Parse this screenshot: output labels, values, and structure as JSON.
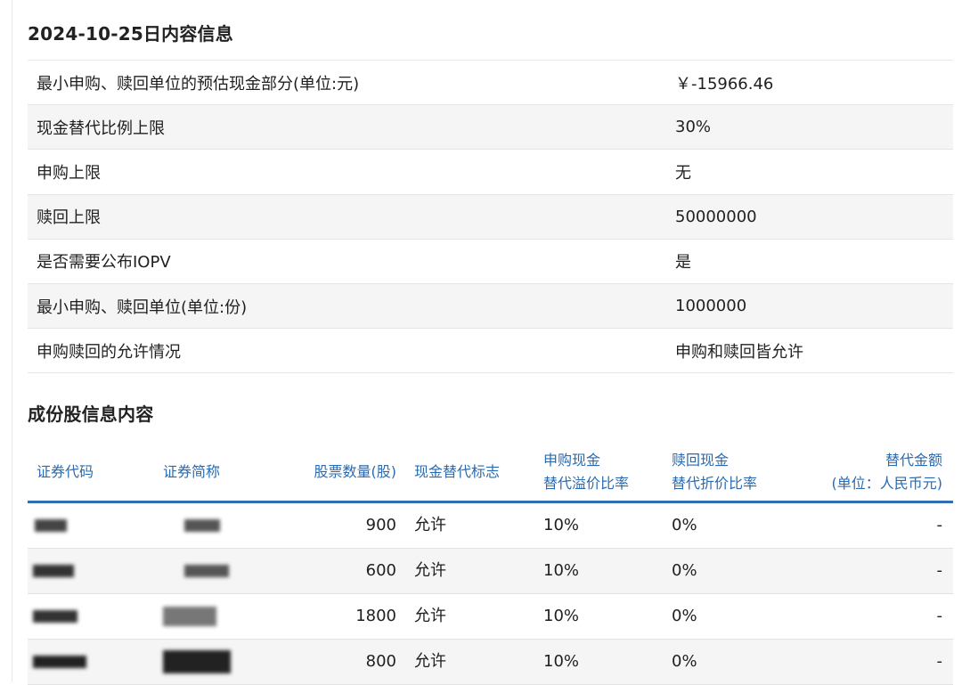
{
  "section1": {
    "title": "2024-10-25日内容信息",
    "rows": [
      {
        "label": "最小申购、赎回单位的预估现金部分(单位:元)",
        "value": "￥-15966.46"
      },
      {
        "label": "现金替代比例上限",
        "value": "30%"
      },
      {
        "label": "申购上限",
        "value": "无"
      },
      {
        "label": "赎回上限",
        "value": "50000000"
      },
      {
        "label": "是否需要公布IOPV",
        "value": "是"
      },
      {
        "label": "最小申购、赎回单位(单位:份)",
        "value": "1000000"
      },
      {
        "label": "申购赎回的允许情况",
        "value": "申购和赎回皆允许"
      }
    ]
  },
  "section2": {
    "title": "成份股信息内容",
    "header": {
      "code": "证券代码",
      "name": "证券简称",
      "qty": "股票数量(股)",
      "flag": "现金替代标志",
      "premium_1": "申购现金",
      "premium_2": "替代溢价比率",
      "discount_1": "赎回现金",
      "discount_2": "替代折价比率",
      "amount_1": "替代金额",
      "amount_2": "(单位：人民币元)"
    },
    "rows": [
      {
        "qty": "900",
        "flag": "允许",
        "premium": "10%",
        "discount": "0%",
        "amount": "-"
      },
      {
        "qty": "600",
        "flag": "允许",
        "premium": "10%",
        "discount": "0%",
        "amount": "-"
      },
      {
        "qty": "1800",
        "flag": "允许",
        "premium": "10%",
        "discount": "0%",
        "amount": "-"
      },
      {
        "qty": "800",
        "flag": "允许",
        "premium": "10%",
        "discount": "0%",
        "amount": "-"
      }
    ]
  },
  "colors": {
    "header_text": "#2a6bb0",
    "header_rule": "#2f6fb3",
    "stripe": "#f5f5f5"
  }
}
